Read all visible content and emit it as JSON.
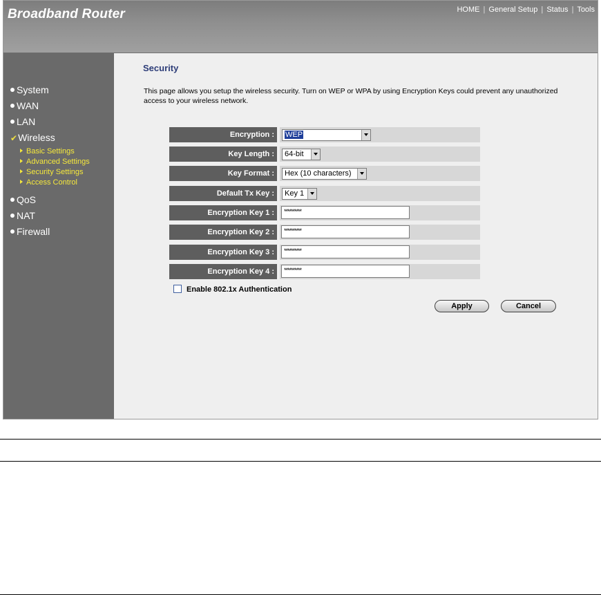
{
  "header": {
    "brand": "Broadband Router",
    "nav": [
      "HOME",
      "General Setup",
      "Status",
      "Tools"
    ],
    "separator": "|"
  },
  "sidebar": {
    "items": [
      {
        "label": "System",
        "marker": "dot"
      },
      {
        "label": "WAN",
        "marker": "dot"
      },
      {
        "label": "LAN",
        "marker": "dot"
      },
      {
        "label": "Wireless",
        "marker": "check"
      },
      {
        "label": "QoS",
        "marker": "dot"
      },
      {
        "label": "NAT",
        "marker": "dot"
      },
      {
        "label": "Firewall",
        "marker": "dot"
      }
    ],
    "wireless_subitems": [
      "Basic Settings",
      "Advanced Settings",
      "Security Settings",
      "Access Control"
    ]
  },
  "page": {
    "title": "Security",
    "description": "This page allows you setup the wireless security. Turn on WEP or WPA by using Encryption Keys could prevent any unauthorized access to your wireless network."
  },
  "form": {
    "encryption": {
      "label": "Encryption :",
      "value": "WEP"
    },
    "key_length": {
      "label": "Key Length :",
      "value": "64-bit"
    },
    "key_format": {
      "label": "Key Format :",
      "value": "Hex (10 characters)"
    },
    "default_tx_key": {
      "label": "Default Tx Key :",
      "value": "Key 1"
    },
    "keys": [
      {
        "label": "Encryption Key 1 :",
        "value": "**********"
      },
      {
        "label": "Encryption Key 2 :",
        "value": "**********"
      },
      {
        "label": "Encryption Key 3 :",
        "value": "**********"
      },
      {
        "label": "Encryption Key 4 :",
        "value": "**********"
      }
    ],
    "auth_checkbox": {
      "label": "Enable 802.1x Authentication",
      "checked": false
    },
    "apply_label": "Apply",
    "cancel_label": "Cancel"
  },
  "colors": {
    "sidebar_bg": "#6a6a6a",
    "label_bg": "#5e5e5e",
    "value_bg": "#d7d7d7",
    "subitem": "#f5e83c",
    "title": "#2d3d78"
  }
}
